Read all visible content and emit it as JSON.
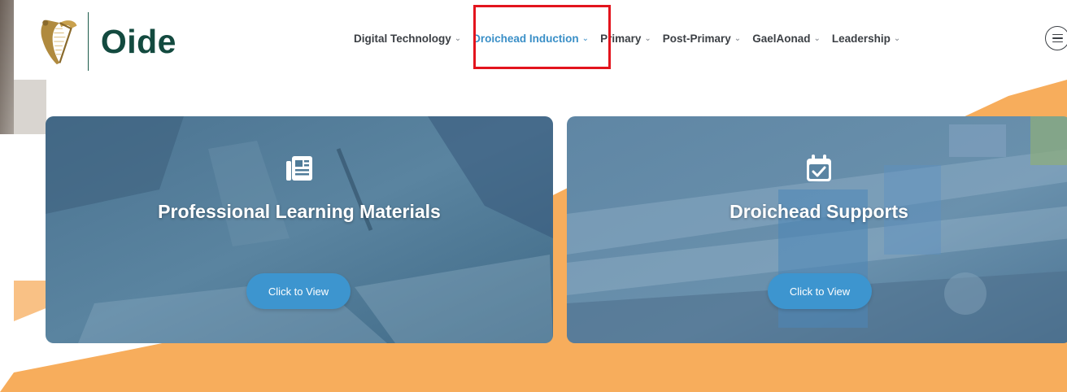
{
  "header": {
    "logo_text": "Oide",
    "nav": [
      {
        "label": "Digital Technology"
      },
      {
        "label": "Droichead Induction"
      },
      {
        "label": "Primary"
      },
      {
        "label": "Post-Primary"
      },
      {
        "label": "GaelAonad"
      },
      {
        "label": "Leadership"
      }
    ],
    "active_nav": "Droichead Induction",
    "chevron": "⌄"
  },
  "cards": [
    {
      "icon": "newspaper-icon",
      "title": "Professional Learning Materials",
      "button_label": "Click to View"
    },
    {
      "icon": "calendar-check-icon",
      "title": "Droichead Supports",
      "button_label": "Click to View"
    }
  ],
  "colors": {
    "brand_green": "#134a3f",
    "accent_blue": "#3a8fc7",
    "button_blue": "#3d95cf",
    "orange_background": "#f7ad5c",
    "highlight_red": "#e3141d",
    "card_overlay": "#3e6f8e"
  }
}
